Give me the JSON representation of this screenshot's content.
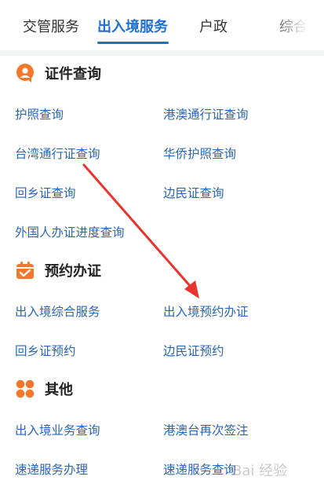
{
  "tabs": [
    {
      "label": "交管服务",
      "active": false
    },
    {
      "label": "出入境服务",
      "active": true
    },
    {
      "label": "户政",
      "active": false
    },
    {
      "label": "综合",
      "active": false
    }
  ],
  "sections": [
    {
      "title": "证件查询",
      "icon": "document-search-icon",
      "items": [
        "护照查询",
        "港澳通行证查询",
        "台湾通行证查询",
        "华侨护照查询",
        "回乡证查询",
        "边民证查询",
        "外国人办证进度查询"
      ]
    },
    {
      "title": "预约办证",
      "icon": "calendar-icon",
      "items": [
        "出入境综合服务",
        "出入境预约办证",
        "回乡证预约",
        "边民证预约"
      ]
    },
    {
      "title": "其他",
      "icon": "grid-icon",
      "items": [
        "出入境业务查询",
        "港澳台再次签注",
        "速递服务办理",
        "速递服务查询"
      ]
    }
  ],
  "watermark": "Bai 经验",
  "colors": {
    "accent": "#1f6fd1",
    "link": "#2a66b5",
    "icon": "#f5772b",
    "arrow": "#e8332f"
  }
}
